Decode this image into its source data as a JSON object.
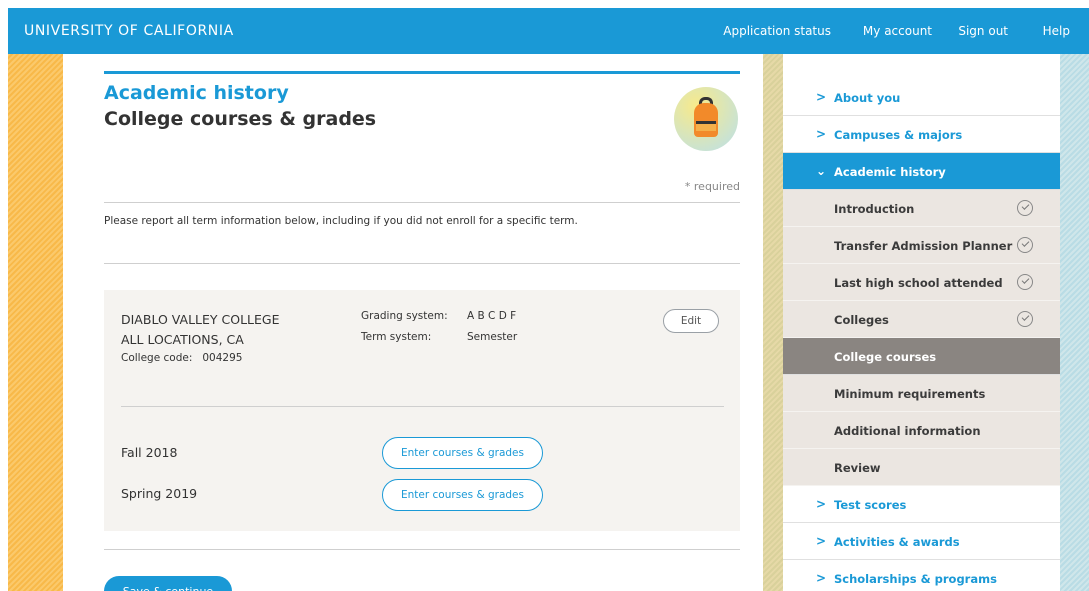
{
  "header": {
    "brand": "UNIVERSITY OF CALIFORNIA",
    "nav": [
      "Application status",
      "My account",
      "Sign out",
      "Help"
    ]
  },
  "page": {
    "section_title": "Academic history",
    "title": "College courses & grades",
    "required_note": "* required",
    "instruction": "Please report all term information below, including if you did not enroll for a specific term."
  },
  "college": {
    "name": "DIABLO VALLEY COLLEGE",
    "location": "ALL LOCATIONS, CA",
    "code_label": "College code:",
    "code": "004295",
    "grading_label": "Grading system:",
    "grading_value": "A B C D F",
    "term_label": "Term system:",
    "term_value": "Semester",
    "edit_label": "Edit",
    "terms": [
      {
        "name": "Fall 2018",
        "button": "Enter courses & grades"
      },
      {
        "name": "Spring 2019",
        "button": "Enter courses & grades"
      }
    ]
  },
  "save_label": "Save & continue",
  "sidebar": {
    "items": [
      {
        "label": "About you",
        "kind": "top"
      },
      {
        "label": "Campuses & majors",
        "kind": "top"
      },
      {
        "label": "Academic history",
        "kind": "active"
      },
      {
        "label": "Introduction",
        "kind": "sub",
        "done": true
      },
      {
        "label": "Transfer Admission Planner",
        "kind": "sub",
        "done": true
      },
      {
        "label": "Last high school attended",
        "kind": "sub",
        "done": true
      },
      {
        "label": "Colleges",
        "kind": "sub",
        "done": true
      },
      {
        "label": "College courses",
        "kind": "current"
      },
      {
        "label": "Minimum requirements",
        "kind": "sub"
      },
      {
        "label": "Additional information",
        "kind": "sub"
      },
      {
        "label": "Review",
        "kind": "sub"
      },
      {
        "label": "Test scores",
        "kind": "top"
      },
      {
        "label": "Activities & awards",
        "kind": "top"
      },
      {
        "label": "Scholarships & programs",
        "kind": "top"
      }
    ]
  },
  "colors": {
    "accent": "#1a99d6",
    "sidebar_sub_bg": "#ebe6e1",
    "sidebar_current_bg": "#8a8581",
    "card_bg": "#f5f3f0"
  }
}
